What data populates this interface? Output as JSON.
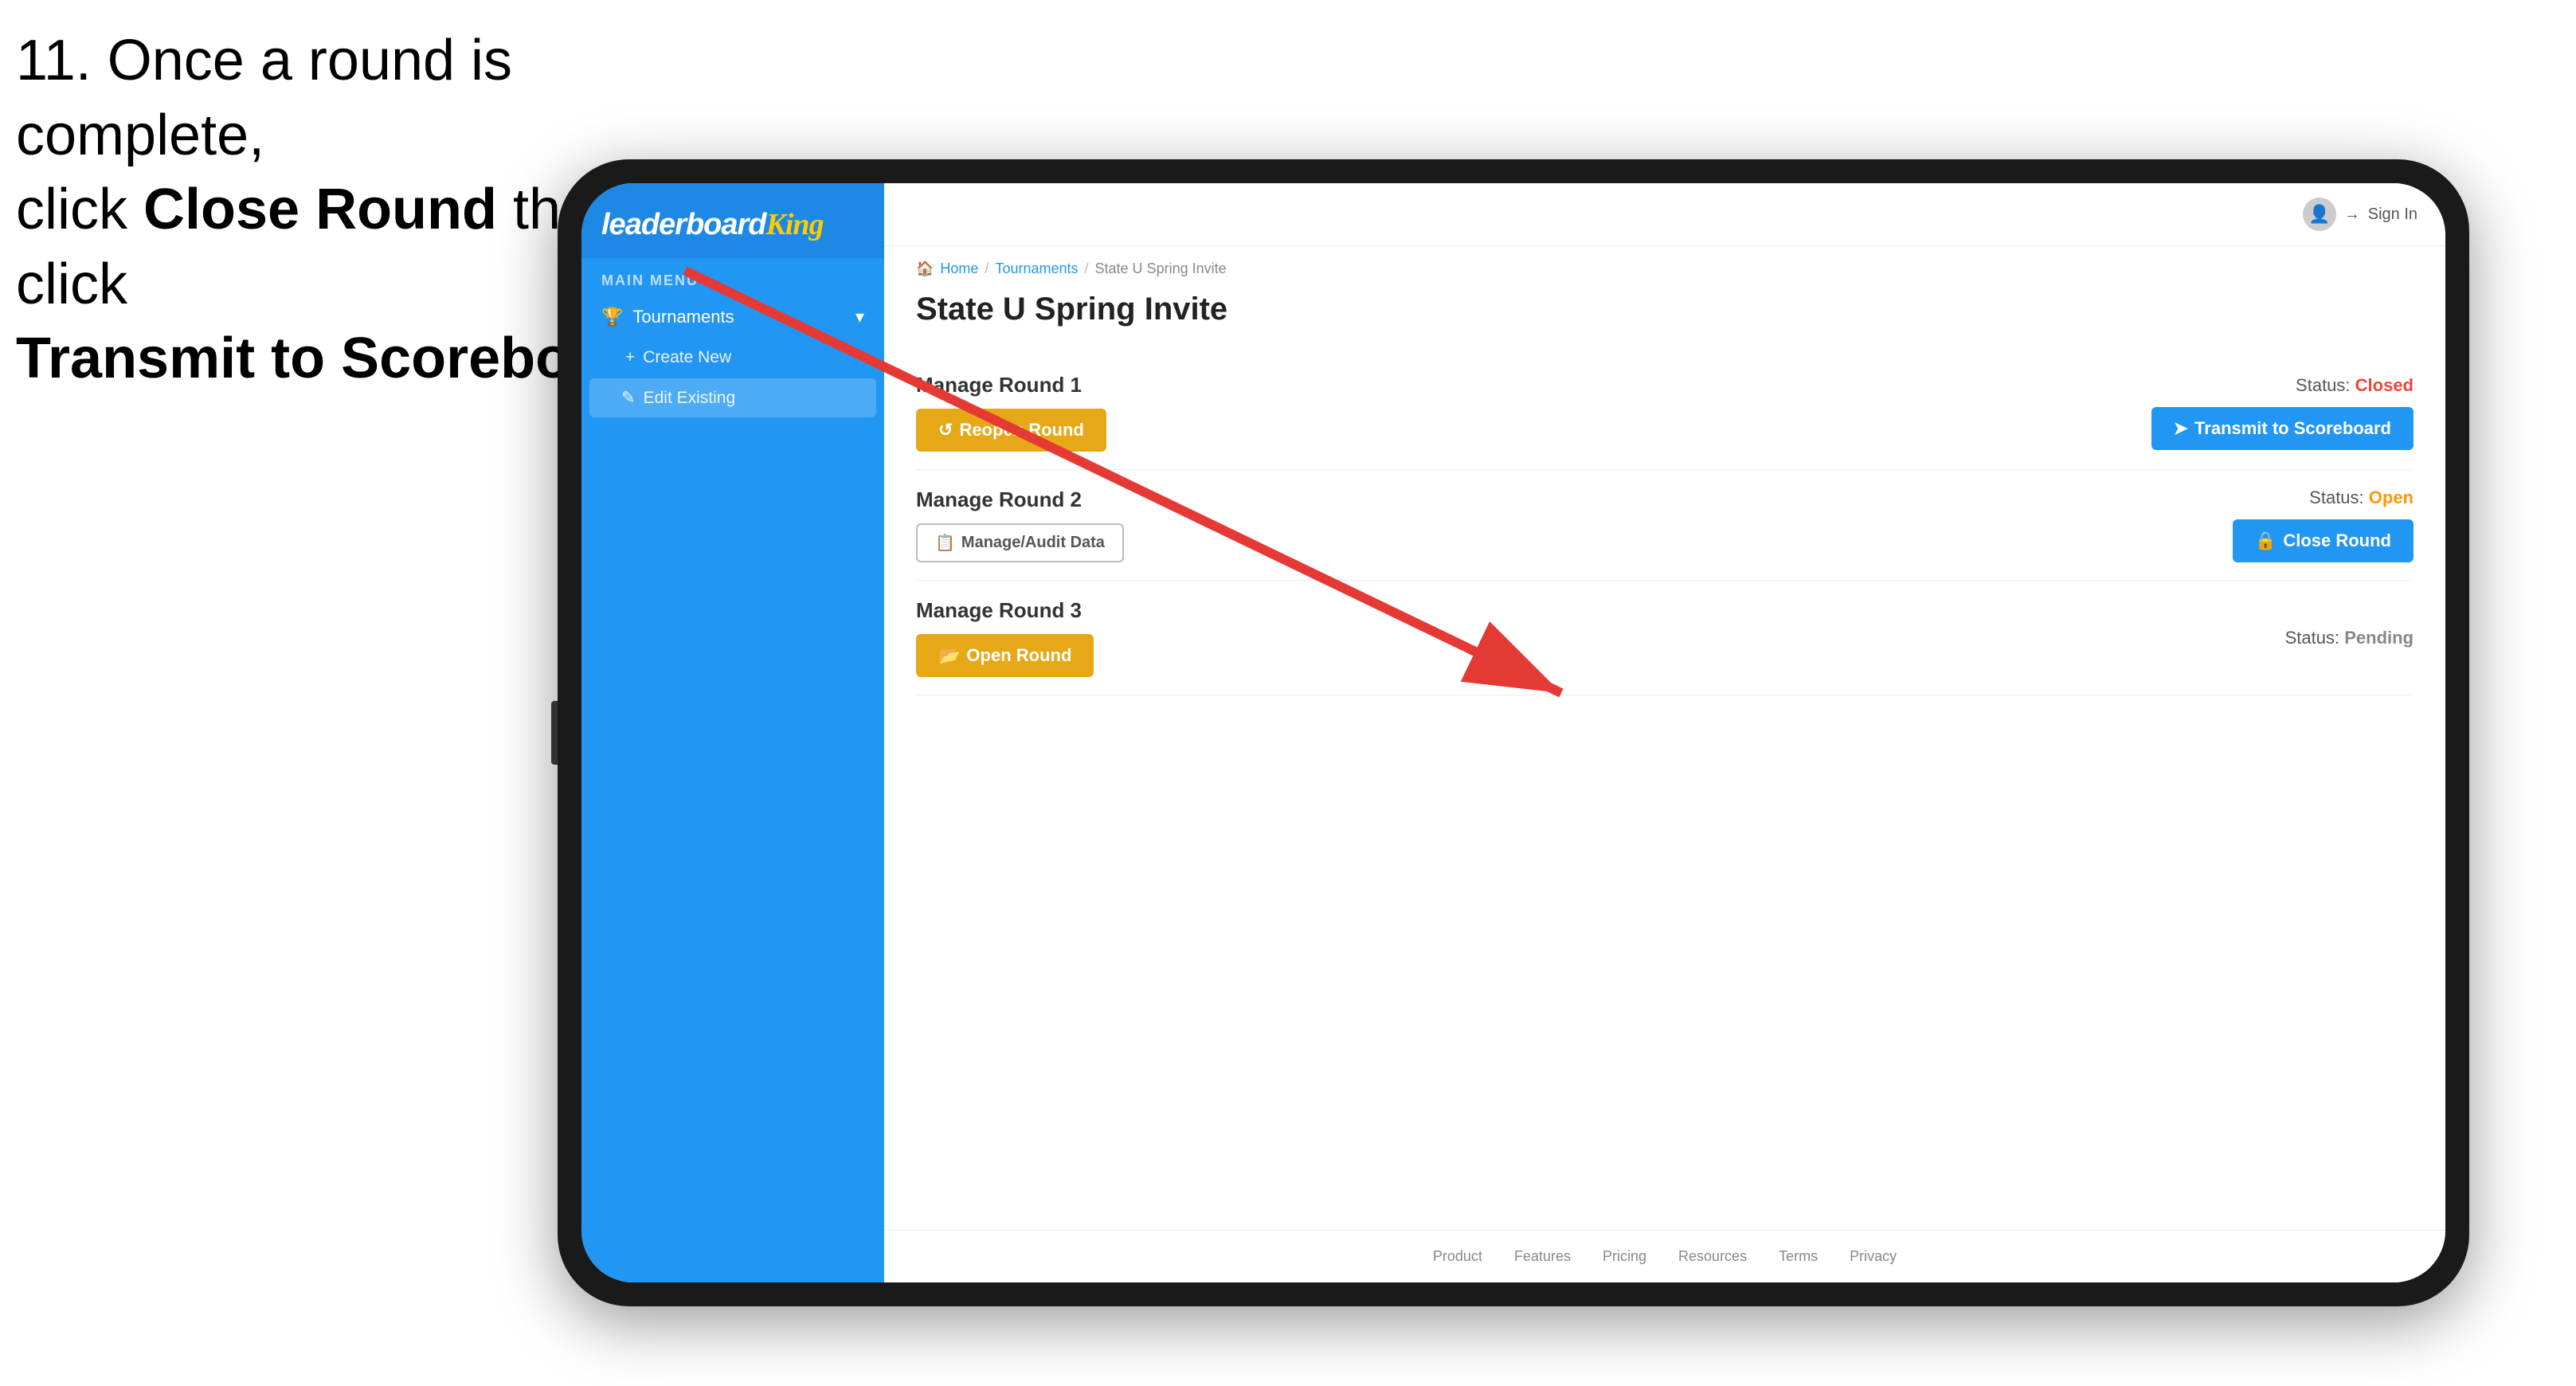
{
  "instruction": {
    "line1": "11. Once a round is complete,",
    "line2": "click ",
    "bold1": "Close Round",
    "line3": " then click",
    "bold2": "Transmit to Scoreboard."
  },
  "logo": {
    "leaderboard": "leaderboard",
    "king": "King"
  },
  "sidebar": {
    "main_menu_label": "MAIN MENU",
    "tournaments_label": "Tournaments",
    "create_new_label": "Create New",
    "edit_existing_label": "Edit Existing"
  },
  "header": {
    "sign_in_label": "Sign In"
  },
  "breadcrumb": {
    "home": "Home",
    "tournaments": "Tournaments",
    "current": "State U Spring Invite"
  },
  "page": {
    "title": "State U Spring Invite",
    "rounds": [
      {
        "id": "round1",
        "title": "Manage Round 1",
        "status_label": "Status:",
        "status_value": "Closed",
        "status_class": "status-closed",
        "btn_left_label": "Reopen Round",
        "btn_right_label": "Transmit to Scoreboard",
        "btn_left_type": "amber",
        "btn_right_type": "blue"
      },
      {
        "id": "round2",
        "title": "Manage Round 2",
        "status_label": "Status:",
        "status_value": "Open",
        "status_class": "status-open",
        "btn_left_label": "Manage/Audit Data",
        "btn_right_label": "Close Round",
        "btn_left_type": "outline",
        "btn_right_type": "blue"
      },
      {
        "id": "round3",
        "title": "Manage Round 3",
        "status_label": "Status:",
        "status_value": "Pending",
        "status_class": "status-pending",
        "btn_left_label": "Open Round",
        "btn_right_label": null,
        "btn_left_type": "amber",
        "btn_right_type": null
      }
    ]
  },
  "footer": {
    "links": [
      "Product",
      "Features",
      "Pricing",
      "Resources",
      "Terms",
      "Privacy"
    ]
  },
  "icons": {
    "trophy": "🏆",
    "chevron_down": "▾",
    "plus": "+",
    "edit": "✎",
    "reopen": "↺",
    "transmit": "➤",
    "close": "🔒",
    "open": "📂",
    "audit": "📋",
    "user": "👤",
    "arrow_right": "→",
    "home": "🏠"
  },
  "colors": {
    "blue_primary": "#2196f3",
    "amber": "#e6a817",
    "red": "#f44336",
    "orange": "#ff9800",
    "sidebar_bg": "#2196f3"
  }
}
